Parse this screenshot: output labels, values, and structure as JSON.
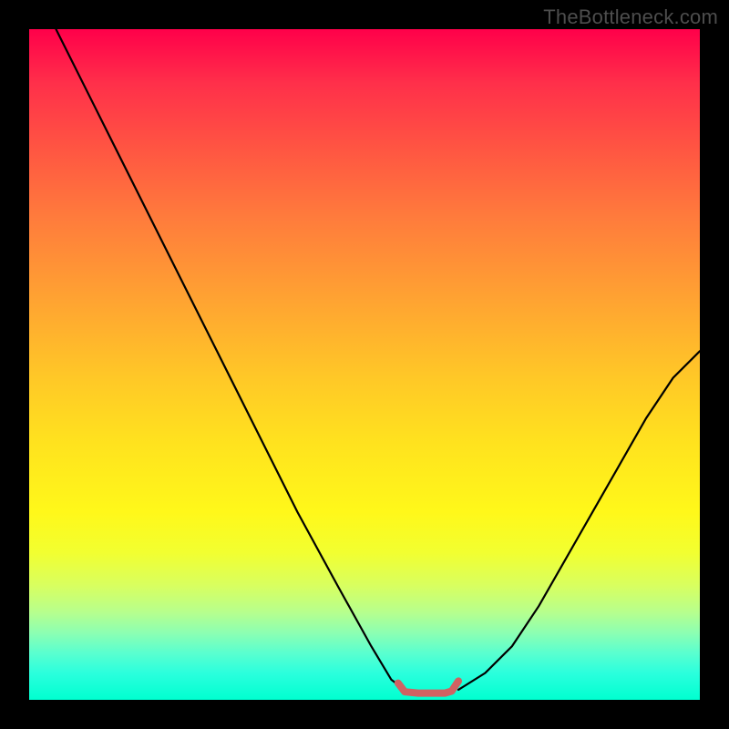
{
  "watermark": "TheBottleneck.com",
  "chart_data": {
    "type": "line",
    "title": "",
    "xlabel": "",
    "ylabel": "",
    "xlim": [
      0,
      100
    ],
    "ylim": [
      0,
      100
    ],
    "grid": false,
    "legend": false,
    "gradient_stops": [
      {
        "pct": 0,
        "color": "#ff004a"
      },
      {
        "pct": 18,
        "color": "#ff5642"
      },
      {
        "pct": 40,
        "color": "#ffa232"
      },
      {
        "pct": 62,
        "color": "#ffe31e"
      },
      {
        "pct": 80,
        "color": "#e6ff40"
      },
      {
        "pct": 100,
        "color": "#00ffd0"
      }
    ],
    "series": [
      {
        "name": "left-curve",
        "color": "#000000",
        "x": [
          4,
          10,
          16,
          22,
          28,
          34,
          40,
          46,
          51,
          54,
          56
        ],
        "y": [
          100,
          88,
          76,
          64,
          52,
          40,
          28,
          17,
          8,
          3,
          1.5
        ]
      },
      {
        "name": "right-curve",
        "color": "#000000",
        "x": [
          64,
          68,
          72,
          76,
          80,
          84,
          88,
          92,
          96,
          100
        ],
        "y": [
          1.5,
          4,
          8,
          14,
          21,
          28,
          35,
          42,
          48,
          52
        ]
      },
      {
        "name": "bottom-segment",
        "color": "#d06262",
        "stroke_width": 8,
        "x": [
          55,
          56,
          58,
          60,
          62,
          63,
          64
        ],
        "y": [
          2.5,
          1.2,
          1.0,
          1.0,
          1.0,
          1.3,
          2.8
        ]
      }
    ]
  }
}
